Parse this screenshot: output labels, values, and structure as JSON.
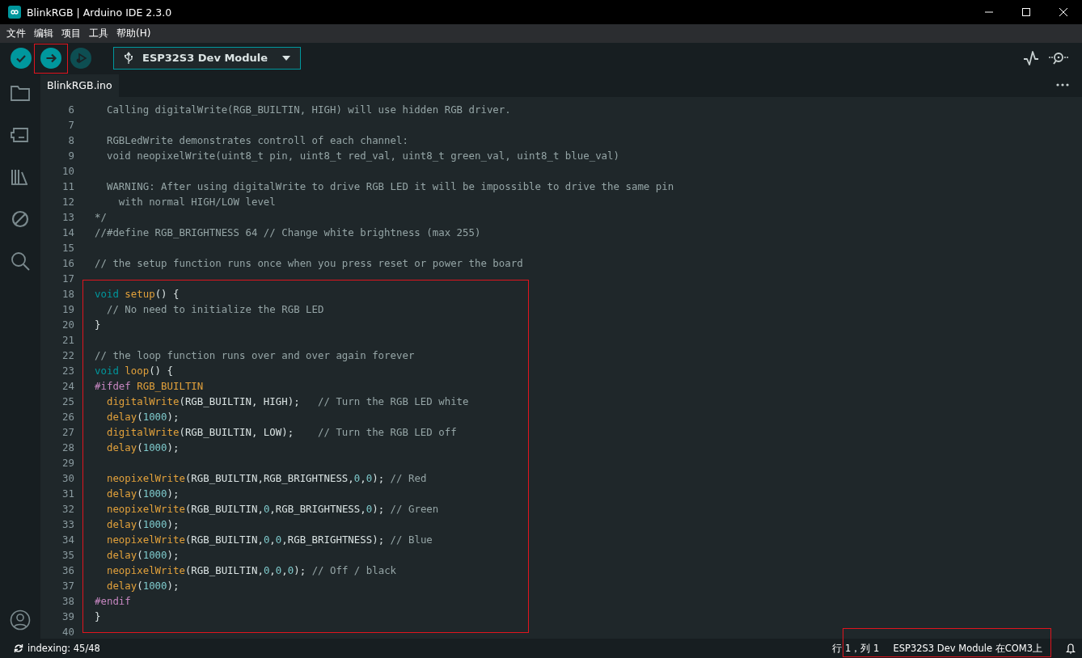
{
  "window": {
    "title": "BlinkRGB | Arduino IDE 2.3.0"
  },
  "menu": [
    "文件",
    "编辑",
    "项目",
    "工具",
    "帮助(H)"
  ],
  "toolbar": {
    "buttons": [
      {
        "kind": "verify",
        "disabled": false
      },
      {
        "kind": "upload",
        "disabled": false
      },
      {
        "kind": "debug",
        "disabled": true
      }
    ],
    "board": "ESP32S3 Dev Module"
  },
  "sidebar": {
    "items": [
      {
        "kind": "folder"
      },
      {
        "kind": "boards"
      },
      {
        "kind": "library"
      },
      {
        "kind": "debug"
      },
      {
        "kind": "search"
      }
    ]
  },
  "tabs": [
    {
      "label": "BlinkRGB.ino",
      "selected": true
    }
  ],
  "editor": {
    "lines": [
      {
        "number": "6",
        "tokens": [
          {
            "kind": "comment",
            "text": "  Calling digitalWrite(RGB_BUILTIN, HIGH) will use hidden RGB driver."
          }
        ]
      },
      {
        "number": "7"
      },
      {
        "number": "8",
        "tokens": [
          {
            "kind": "comment",
            "text": "  RGBLedWrite demonstrates controll of each channel:"
          }
        ]
      },
      {
        "number": "9",
        "tokens": [
          {
            "kind": "comment",
            "text": "  void neopixelWrite(uint8_t pin, uint8_t red_val, uint8_t green_val, uint8_t blue_val)"
          }
        ]
      },
      {
        "number": "10"
      },
      {
        "number": "11",
        "tokens": [
          {
            "kind": "comment",
            "text": "  WARNING: After using digitalWrite to drive RGB LED it will be impossible to drive the same pin"
          }
        ]
      },
      {
        "number": "12",
        "tokens": [
          {
            "kind": "comment",
            "text": "    with normal HIGH/LOW level"
          }
        ]
      },
      {
        "number": "13",
        "tokens": [
          {
            "kind": "comment",
            "text": "*/"
          }
        ]
      },
      {
        "number": "14",
        "tokens": [
          {
            "kind": "comment",
            "text": "//#define RGB_BRIGHTNESS 64 // Change white brightness (max 255)"
          }
        ]
      },
      {
        "number": "15"
      },
      {
        "number": "16",
        "tokens": [
          {
            "kind": "comment",
            "text": "// the setup function runs once when you press reset or power the board"
          }
        ]
      },
      {
        "number": "17"
      },
      {
        "number": "18",
        "tokens": [
          {
            "kind": "keyword",
            "text": "void "
          },
          {
            "kind": "function",
            "text": "setup"
          },
          {
            "kind": "plain",
            "text": "() {"
          }
        ]
      },
      {
        "number": "19",
        "tokens": [
          {
            "kind": "comment",
            "text": "  // No need to initialize the RGB LED"
          }
        ]
      },
      {
        "number": "20",
        "tokens": [
          {
            "kind": "plain",
            "text": "}"
          }
        ]
      },
      {
        "number": "21"
      },
      {
        "number": "22",
        "tokens": [
          {
            "kind": "comment",
            "text": "// the loop function runs over and over again forever"
          }
        ]
      },
      {
        "number": "23",
        "tokens": [
          {
            "kind": "keyword",
            "text": "void "
          },
          {
            "kind": "function",
            "text": "loop"
          },
          {
            "kind": "plain",
            "text": "() {"
          }
        ]
      },
      {
        "number": "24",
        "tokens": [
          {
            "kind": "directive",
            "text": "#ifdef "
          },
          {
            "kind": "function",
            "text": "RGB_BUILTIN"
          }
        ]
      },
      {
        "number": "25",
        "tokens": [
          {
            "kind": "function",
            "text": "  digitalWrite"
          },
          {
            "kind": "plain",
            "text": "(RGB_BUILTIN, HIGH);   "
          },
          {
            "kind": "comment",
            "text": "// Turn the RGB LED white"
          }
        ]
      },
      {
        "number": "26",
        "tokens": [
          {
            "kind": "function",
            "text": "  delay"
          },
          {
            "kind": "plain",
            "text": "("
          },
          {
            "kind": "number",
            "text": "1000"
          },
          {
            "kind": "plain",
            "text": ");"
          }
        ]
      },
      {
        "number": "27",
        "tokens": [
          {
            "kind": "function",
            "text": "  digitalWrite"
          },
          {
            "kind": "plain",
            "text": "(RGB_BUILTIN, LOW);    "
          },
          {
            "kind": "comment",
            "text": "// Turn the RGB LED off"
          }
        ]
      },
      {
        "number": "28",
        "tokens": [
          {
            "kind": "function",
            "text": "  delay"
          },
          {
            "kind": "plain",
            "text": "("
          },
          {
            "kind": "number",
            "text": "1000"
          },
          {
            "kind": "plain",
            "text": ");"
          }
        ]
      },
      {
        "number": "29"
      },
      {
        "number": "30",
        "tokens": [
          {
            "kind": "function",
            "text": "  neopixelWrite"
          },
          {
            "kind": "plain",
            "text": "(RGB_BUILTIN,RGB_BRIGHTNESS,"
          },
          {
            "kind": "number",
            "text": "0"
          },
          {
            "kind": "plain",
            "text": ","
          },
          {
            "kind": "number",
            "text": "0"
          },
          {
            "kind": "plain",
            "text": "); "
          },
          {
            "kind": "comment",
            "text": "// Red"
          }
        ]
      },
      {
        "number": "31",
        "tokens": [
          {
            "kind": "function",
            "text": "  delay"
          },
          {
            "kind": "plain",
            "text": "("
          },
          {
            "kind": "number",
            "text": "1000"
          },
          {
            "kind": "plain",
            "text": ");"
          }
        ]
      },
      {
        "number": "32",
        "tokens": [
          {
            "kind": "function",
            "text": "  neopixelWrite"
          },
          {
            "kind": "plain",
            "text": "(RGB_BUILTIN,"
          },
          {
            "kind": "number",
            "text": "0"
          },
          {
            "kind": "plain",
            "text": ",RGB_BRIGHTNESS,"
          },
          {
            "kind": "number",
            "text": "0"
          },
          {
            "kind": "plain",
            "text": "); "
          },
          {
            "kind": "comment",
            "text": "// Green"
          }
        ]
      },
      {
        "number": "33",
        "tokens": [
          {
            "kind": "function",
            "text": "  delay"
          },
          {
            "kind": "plain",
            "text": "("
          },
          {
            "kind": "number",
            "text": "1000"
          },
          {
            "kind": "plain",
            "text": ");"
          }
        ]
      },
      {
        "number": "34",
        "tokens": [
          {
            "kind": "function",
            "text": "  neopixelWrite"
          },
          {
            "kind": "plain",
            "text": "(RGB_BUILTIN,"
          },
          {
            "kind": "number",
            "text": "0"
          },
          {
            "kind": "plain",
            "text": ","
          },
          {
            "kind": "number",
            "text": "0"
          },
          {
            "kind": "plain",
            "text": ",RGB_BRIGHTNESS); "
          },
          {
            "kind": "comment",
            "text": "// Blue"
          }
        ]
      },
      {
        "number": "35",
        "tokens": [
          {
            "kind": "function",
            "text": "  delay"
          },
          {
            "kind": "plain",
            "text": "("
          },
          {
            "kind": "number",
            "text": "1000"
          },
          {
            "kind": "plain",
            "text": ");"
          }
        ]
      },
      {
        "number": "36",
        "tokens": [
          {
            "kind": "function",
            "text": "  neopixelWrite"
          },
          {
            "kind": "plain",
            "text": "(RGB_BUILTIN,"
          },
          {
            "kind": "number",
            "text": "0"
          },
          {
            "kind": "plain",
            "text": ","
          },
          {
            "kind": "number",
            "text": "0"
          },
          {
            "kind": "plain",
            "text": ","
          },
          {
            "kind": "number",
            "text": "0"
          },
          {
            "kind": "plain",
            "text": "); "
          },
          {
            "kind": "comment",
            "text": "// Off / black"
          }
        ]
      },
      {
        "number": "37",
        "tokens": [
          {
            "kind": "function",
            "text": "  delay"
          },
          {
            "kind": "plain",
            "text": "("
          },
          {
            "kind": "number",
            "text": "1000"
          },
          {
            "kind": "plain",
            "text": ");"
          }
        ]
      },
      {
        "number": "38",
        "tokens": [
          {
            "kind": "directive",
            "text": "#endif"
          }
        ]
      },
      {
        "number": "39",
        "tokens": [
          {
            "kind": "plain",
            "text": "}"
          }
        ]
      },
      {
        "number": "40"
      }
    ]
  },
  "status_bar": {
    "indexing": "indexing: 45/48",
    "position": "行 1，列 1",
    "board_port": "ESP32S3 Dev Module 在COM3上"
  }
}
